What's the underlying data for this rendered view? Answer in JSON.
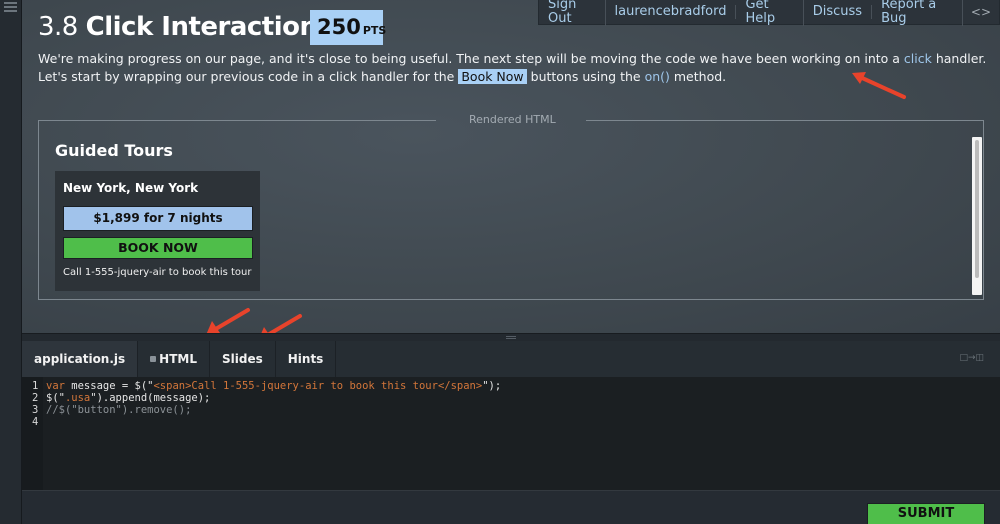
{
  "header": {
    "lesson_number": "3.8",
    "lesson_title": "Click Interaction",
    "points_value": "250",
    "points_unit": "PTS"
  },
  "topnav": {
    "items": [
      "Sign Out",
      "laurencebradford",
      "Get Help",
      "Discuss",
      "Report a Bug"
    ],
    "toggle_icon": "code-brackets-icon"
  },
  "description": {
    "part1": "We're making progress on our page, and it's close to being useful. The next step will be moving the code we have been working on into a ",
    "link_click": "click",
    "part2": " handler. Let's start by wrapping our previous code in a click handler for the ",
    "tag_book_now": "Book Now",
    "part3": " buttons using the ",
    "link_on": "on()",
    "part4": " method."
  },
  "rendered": {
    "label": "Rendered HTML",
    "section_title": "Guided Tours",
    "tour": {
      "name": "New York, New York",
      "price": "$1,899 for 7 nights",
      "button": "BOOK NOW",
      "call": "Call 1-555-jquery-air to book this tour"
    }
  },
  "editor": {
    "tabs": [
      {
        "label": "application.js",
        "active": true,
        "locked": false
      },
      {
        "label": "HTML",
        "active": false,
        "locked": true
      },
      {
        "label": "Slides",
        "active": false,
        "locked": false
      },
      {
        "label": "Hints",
        "active": false,
        "locked": false
      }
    ],
    "lines": [
      {
        "n": "1",
        "kw": "var",
        "pre": " message = $(\"",
        "str": "<span>Call 1-555-jquery-air to book this tour</span>",
        "post": "\");"
      },
      {
        "n": "2",
        "pre": "$(\"",
        "str": ".usa",
        "post": "\").append(message);"
      },
      {
        "n": "3",
        "comment": "//$(\"button\").remove();"
      },
      {
        "n": "4"
      }
    ],
    "layout_toggle_icon": "split-layout-icon"
  },
  "footer": {
    "submit_label": "SUBMIT"
  },
  "colors": {
    "accent_blue": "#a9d0f5",
    "button_green": "#4fbe4a",
    "link_blue": "#9fc6ea",
    "annotation_arrow": "#e8432b"
  }
}
